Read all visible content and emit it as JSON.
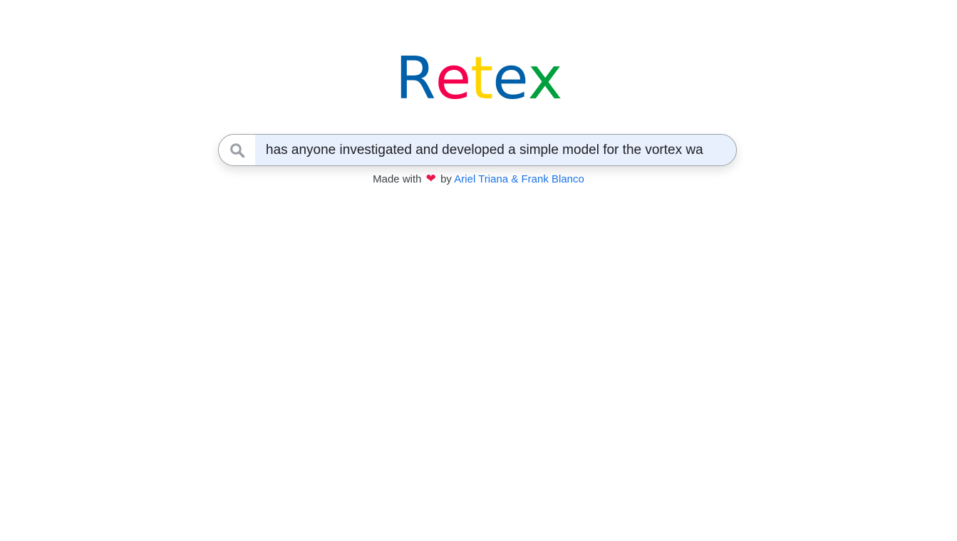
{
  "logo": {
    "letters": [
      {
        "char": "R",
        "color": "#0060a9"
      },
      {
        "char": "e",
        "color": "#f4004f"
      },
      {
        "char": "t",
        "color": "#ffd400"
      },
      {
        "char": "e",
        "color": "#0060a9"
      },
      {
        "char": "x",
        "color": "#00a03e"
      }
    ]
  },
  "search": {
    "icon": "search-icon",
    "value": "has anyone investigated and developed a simple model for the vortex wa"
  },
  "footer": {
    "made_with": "Made with",
    "heart": "❤",
    "by": "by",
    "authors": "Ariel Triana & Frank Blanco"
  },
  "colors": {
    "link": "#1a73e8",
    "input_bg": "#e8f0fe",
    "heart": "#e8174b"
  }
}
